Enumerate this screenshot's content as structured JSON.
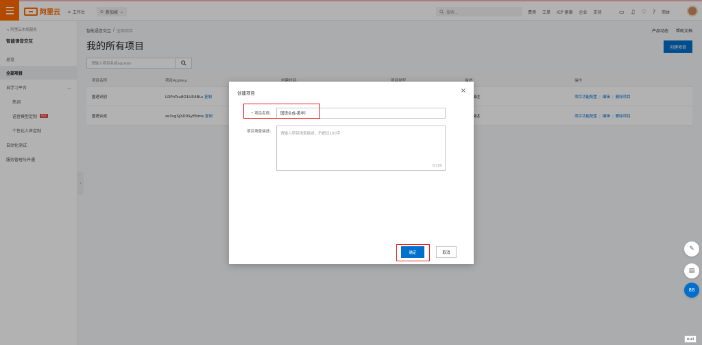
{
  "topbar": {
    "brand": "阿里云",
    "workbench": "工作台",
    "region": "新加坡",
    "search_placeholder": "搜索...",
    "links": [
      "费用",
      "工单",
      "ICP 备案",
      "企业",
      "支持"
    ],
    "lang": "简体"
  },
  "sidebar": {
    "back": "< 阿里云市场服务",
    "title": "智能语音交互",
    "items": [
      {
        "label": "总览"
      },
      {
        "label": "全部项目"
      },
      {
        "label": "自学习平台"
      },
      {
        "label": "热词"
      },
      {
        "label": "语音模型定制",
        "badge": "热卖"
      },
      {
        "label": "个性化人声定制"
      },
      {
        "label": "自动化测试"
      },
      {
        "label": "服务管理与开通"
      }
    ]
  },
  "main": {
    "breadcrumb": [
      "智能语音交互",
      "/",
      "全部项目"
    ],
    "title": "我的所有项目",
    "header_links": [
      "产品动态",
      "帮助文档"
    ],
    "create_label": "创建项目",
    "search_placeholder": "请输入项目名或appkey",
    "columns": [
      "项目名称",
      "项目Appkey:",
      "创建时间:",
      "项目类型",
      "描述:",
      "操作"
    ],
    "rows": [
      {
        "name": "国语识别",
        "appkey": "LDPhTsu8O1UR4BLs",
        "copy": "复制",
        "desc": "暂无描述",
        "actions": [
          "项目功能配置",
          "编辑",
          "删除项目"
        ]
      },
      {
        "name": "国语合成",
        "appkey": "ze3vgSJXD0SyENme",
        "copy": "复制",
        "desc": "暂无描述",
        "actions": [
          "项目功能配置",
          "编辑",
          "删除项目"
        ]
      }
    ]
  },
  "modal": {
    "title": "创建项目",
    "name_label": "项目名称:",
    "name_value": "国语合成-黄华",
    "desc_label": "项目场景描述:",
    "desc_placeholder": "请输入项目场景描述，不超过100字",
    "desc_count": "0/100",
    "ok_label": "确定",
    "cancel_label": "取消"
  },
  "side_tools": {
    "null_tag": "null"
  },
  "colors": {
    "brand": "#ff6a00",
    "primary": "#0070cc",
    "highlight": "#e82020"
  }
}
